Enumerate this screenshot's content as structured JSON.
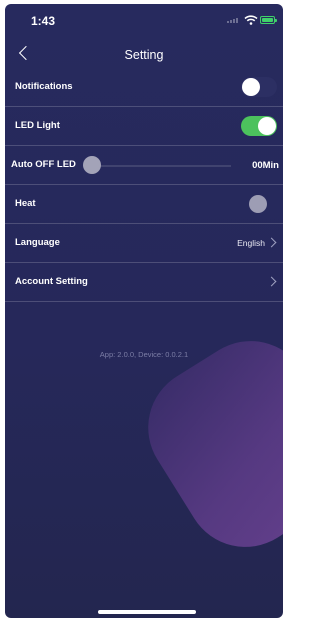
{
  "status": {
    "time": "1:43"
  },
  "header": {
    "title": "Setting"
  },
  "settings": {
    "notifications": {
      "label": "Notifications",
      "toggle": "off"
    },
    "led_light": {
      "label": "LED Light",
      "toggle": "on"
    },
    "auto_off_led": {
      "label": "Auto OFF LED",
      "value": "00Min",
      "slider_level": 0
    },
    "heat": {
      "label": "Heat"
    },
    "language": {
      "label": "Language",
      "value": "English"
    },
    "account_setting": {
      "label": "Account Setting"
    }
  },
  "footer": {
    "version_text": "App: 2.0.0, Device: 0.0.2.1"
  },
  "colors": {
    "toggle_on": "#4cc25d",
    "background": "#272a5e",
    "accent_blob": "#5b3b86"
  },
  "icons": [
    "back-chevron-icon",
    "signal-icon",
    "wifi-icon",
    "battery-icon",
    "chevron-right-icon"
  ]
}
